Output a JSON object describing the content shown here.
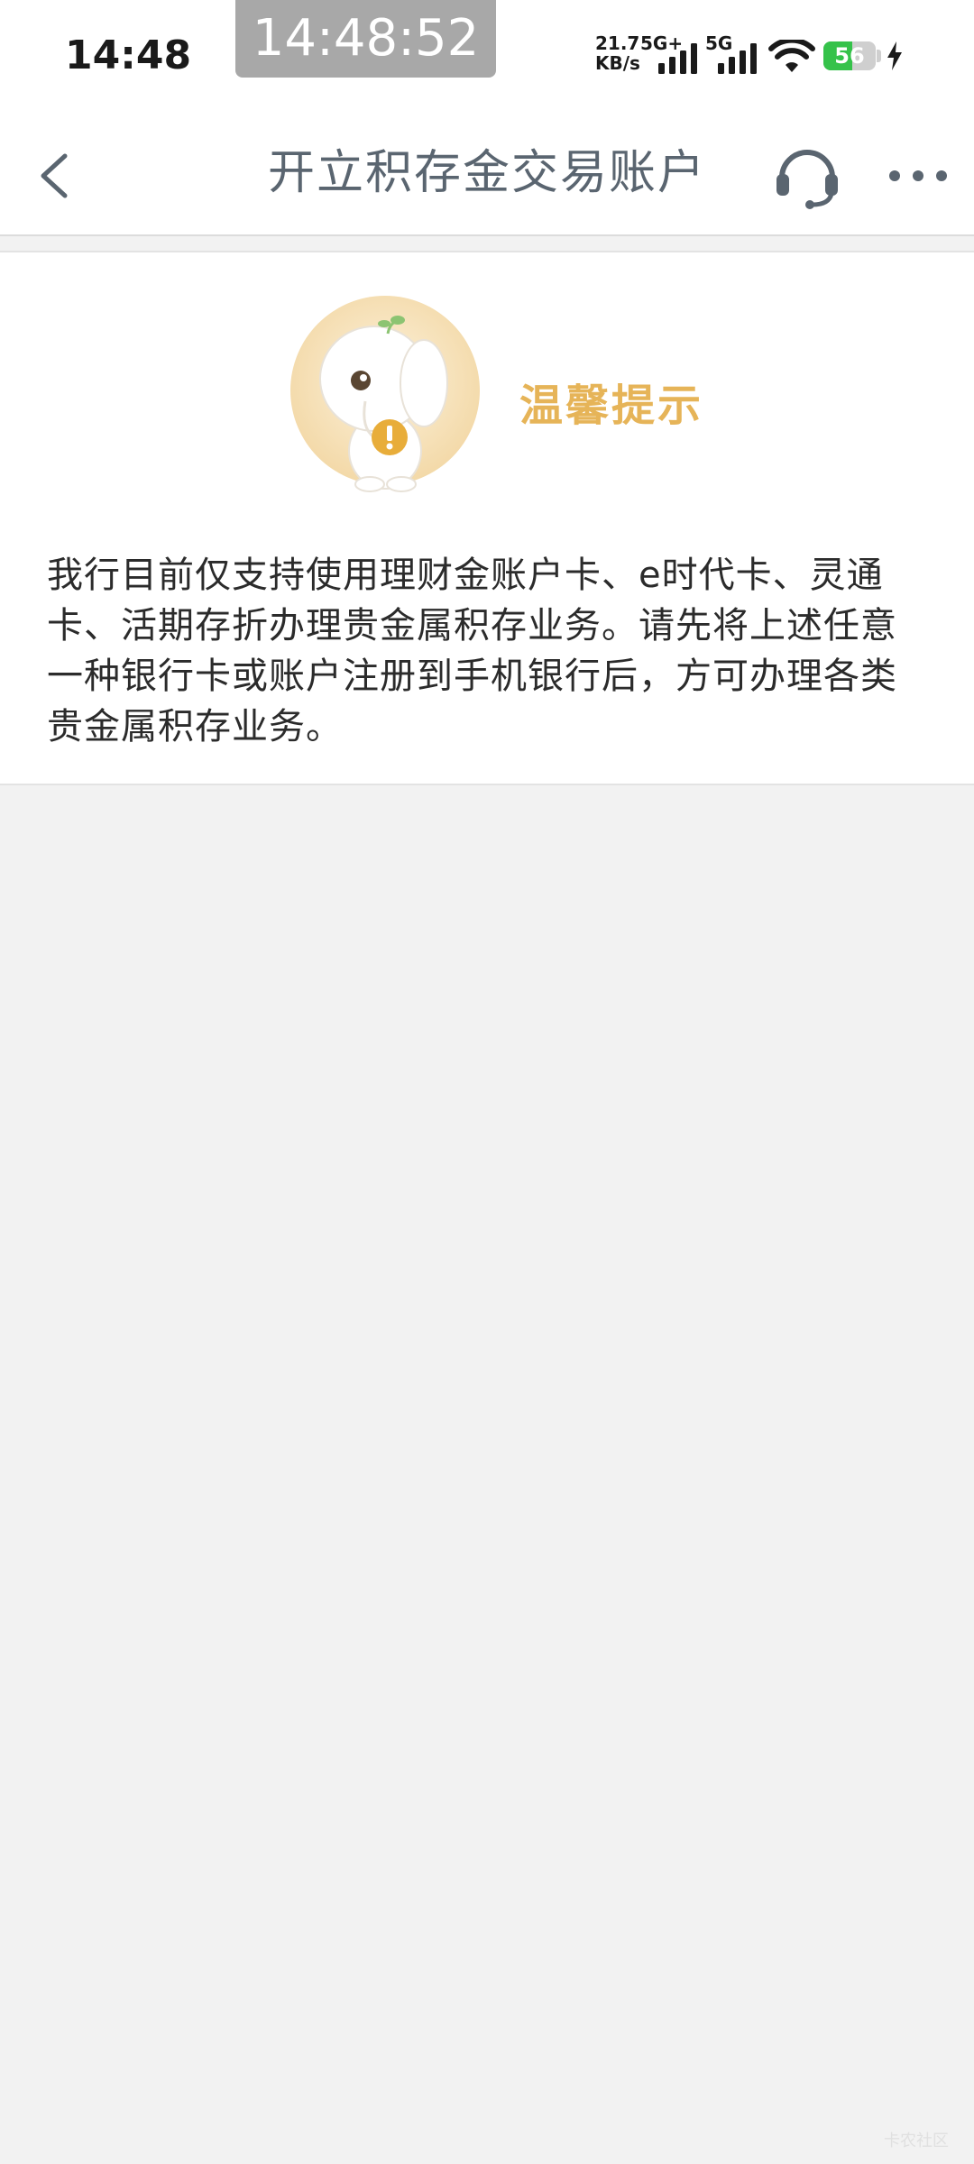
{
  "status_bar": {
    "time": "14:48",
    "clock_overlay": "14:48:52",
    "net_speed_value": "21.7",
    "net_speed_unit": "KB/s",
    "signal1_label": "5G+",
    "signal2_label": "5G",
    "battery_level": "56"
  },
  "nav": {
    "title": "开立积存金交易账户",
    "back_icon": "chevron-left-icon",
    "service_icon": "headset-icon",
    "more_icon": "more-dots-icon"
  },
  "notice": {
    "heading": "温馨提示",
    "body": "我行目前仅支持使用理财金账户卡、e时代卡、灵通卡、活期存折办理贵金属积存业务。请先将上述任意一种银行卡或账户注册到手机银行后，方可办理各类贵金属积存业务。",
    "accent_color": "#e6b458"
  },
  "watermark": "卡农社区"
}
